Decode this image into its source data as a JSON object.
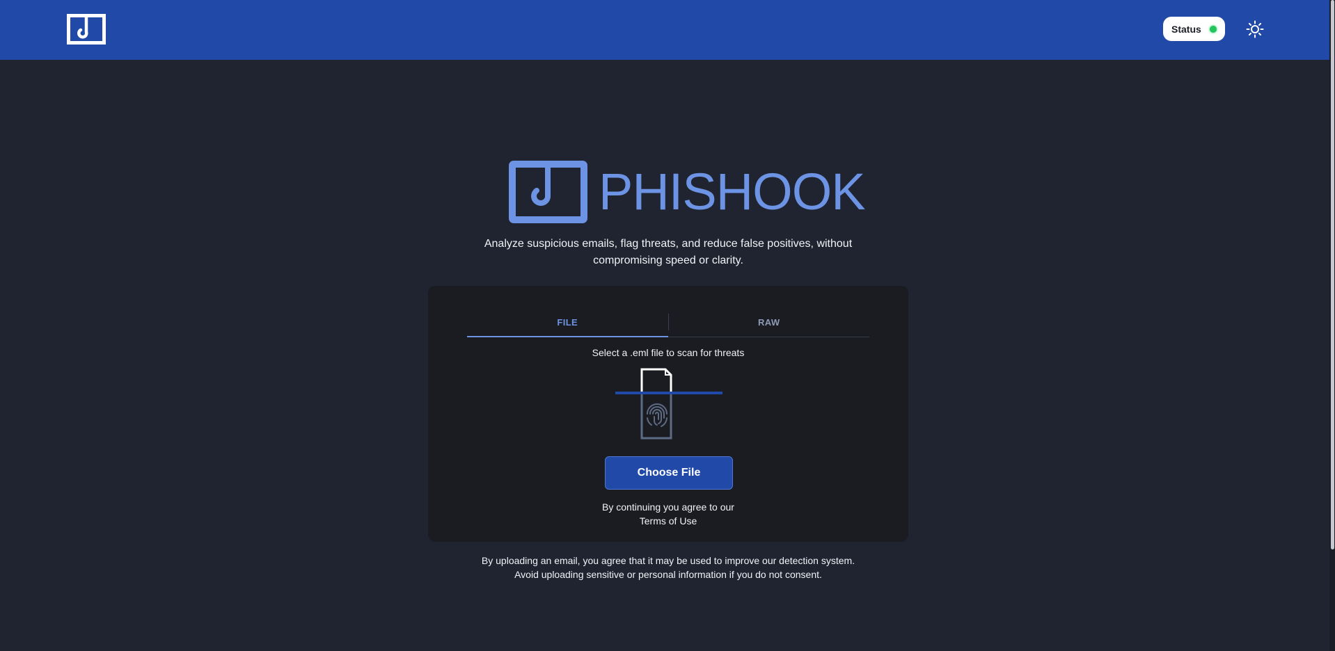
{
  "header": {
    "logo_icon": "hook-box-icon",
    "status_label": "Status",
    "status_color": "#22c55e",
    "theme_icon": "sun-icon",
    "bg_color": "#2149a8"
  },
  "hero": {
    "brand_name": "PHISHOOK",
    "brand_color": "#6d94e4",
    "tagline_line1": "Analyze suspicious emails, flag threats, and reduce false positives, without",
    "tagline_line2": "compromising speed or clarity."
  },
  "upload_card": {
    "tabs": [
      {
        "label": "FILE",
        "active": true
      },
      {
        "label": "RAW",
        "active": false
      }
    ],
    "prompt": "Select a .eml file to scan for threats",
    "illustration_icon": "file-fingerprint-scan-icon",
    "choose_button_label": "Choose File",
    "consent_text": "By continuing you agree to our",
    "terms_link_label": "Terms of Use"
  },
  "footer": {
    "disclaimer_line1": "By uploading an email, you agree that it may be used to improve our detection system.",
    "disclaimer_line2": "Avoid uploading sensitive or personal information if you do not consent."
  }
}
